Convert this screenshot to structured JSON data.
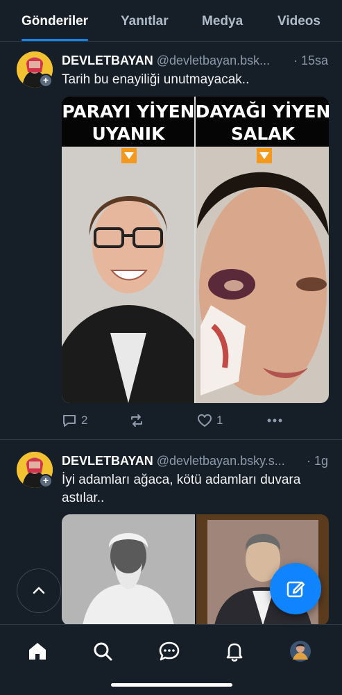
{
  "tabs": [
    {
      "label": "Gönderiler",
      "active": true
    },
    {
      "label": "Yanıtlar",
      "active": false
    },
    {
      "label": "Medya",
      "active": false
    },
    {
      "label": "Videos",
      "active": false
    }
  ],
  "posts": [
    {
      "author_name": "DEVLETBAYAN",
      "author_handle": "@devletbayan.bsk...",
      "time": "· 15sa",
      "text": "Tarih bu enayiliği unutmayacak..",
      "image": {
        "left_caption": [
          "PARAYI YİYEN",
          "UYANIK"
        ],
        "right_caption": [
          "DAYAĞI YİYEN",
          "SALAK"
        ]
      },
      "actions": {
        "replies": "2",
        "reposts": "",
        "likes": "1"
      }
    },
    {
      "author_name": "DEVLETBAYAN",
      "author_handle": "@devletbayan.bsky.s...",
      "time": "· 1g",
      "text": "İyi adamları ağaca, kötü adamları duvara astılar.."
    }
  ],
  "colors": {
    "background": "#161e27",
    "accent": "#1083fe",
    "muted": "#8c9aab"
  },
  "icons": {
    "nav": [
      "home-icon",
      "search-icon",
      "chat-icon",
      "bell-icon",
      "profile-avatar"
    ],
    "floating": [
      "chevron-up-icon",
      "compose-icon"
    ]
  }
}
